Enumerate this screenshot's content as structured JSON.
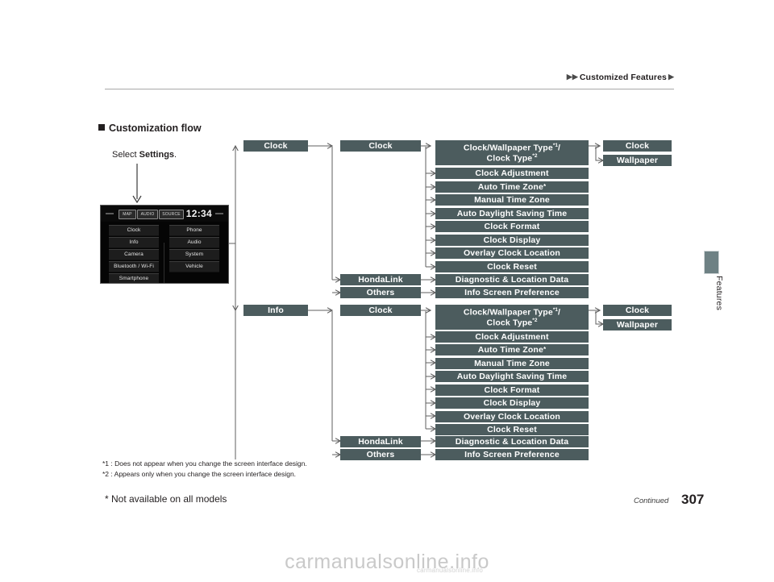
{
  "header": {
    "breadcrumb": "Customized Features",
    "arrow_glyph": "▶"
  },
  "side_tab": {
    "label": "Features"
  },
  "section": {
    "title": "Customization flow"
  },
  "select_step": {
    "prefix": "Select ",
    "bold": "Settings",
    "suffix": "."
  },
  "nav_screen": {
    "clock": "12:34",
    "status_buttons": [
      "MAP",
      "AUDIO",
      "SOURCE"
    ],
    "buttons_left": [
      "Clock",
      "Info",
      "Camera",
      "Bluetooth / Wi-Fi",
      "Smartphone"
    ],
    "buttons_right": [
      "Phone",
      "Audio",
      "System",
      "Vehicle"
    ]
  },
  "flow": {
    "branch1": {
      "col1": "Clock",
      "col2_main": "Clock",
      "col2_hondalink": "HondaLink",
      "col2_others": "Others",
      "col3": [
        {
          "line1": "Clock/Wallpaper Type",
          "sup1": "*1",
          "slash": "/",
          "line2": "Clock Type",
          "sup2": "*2",
          "two_line": true
        },
        {
          "line1": "Clock Adjustment"
        },
        {
          "line1": "Auto Time Zone",
          "asterisk": "*"
        },
        {
          "line1": "Manual Time Zone"
        },
        {
          "line1": "Auto Daylight Saving Time"
        },
        {
          "line1": "Clock Format"
        },
        {
          "line1": "Clock Display"
        },
        {
          "line1": "Overlay Clock Location"
        },
        {
          "line1": "Clock Reset"
        }
      ],
      "col3_hondalink": "Diagnostic & Location Data",
      "col3_others": "Info Screen Preference",
      "col4": [
        "Clock",
        "Wallpaper"
      ]
    },
    "branch2": {
      "col1": "Info",
      "col2_main": "Clock",
      "col2_hondalink": "HondaLink",
      "col2_others": "Others",
      "col3": [
        {
          "line1": "Clock/Wallpaper Type",
          "sup1": "*1",
          "slash": "/",
          "line2": "Clock Type",
          "sup2": "*2",
          "two_line": true
        },
        {
          "line1": "Clock Adjustment"
        },
        {
          "line1": "Auto Time Zone",
          "asterisk": "*"
        },
        {
          "line1": "Manual Time Zone"
        },
        {
          "line1": "Auto Daylight Saving Time"
        },
        {
          "line1": "Clock Format"
        },
        {
          "line1": "Clock Display"
        },
        {
          "line1": "Overlay Clock Location"
        },
        {
          "line1": "Clock Reset"
        }
      ],
      "col3_hondalink": "Diagnostic & Location Data",
      "col3_others": "Info Screen Preference",
      "col4": [
        "Clock",
        "Wallpaper"
      ]
    }
  },
  "footnotes": {
    "fn1": "*1 : Does not appear when you change the screen interface design.",
    "fn2": "*2 : Appears only when you change the screen interface design."
  },
  "footer": {
    "not_available": "* Not available on all models",
    "continued": "Continued",
    "page_number": "307"
  },
  "watermark": {
    "main": "carmanualsonline.info",
    "sub": "carmanualsonline.info"
  },
  "colors": {
    "box_fill": "#4c5c5e",
    "tab": "#6e8184",
    "line": "#5f5f5f"
  }
}
